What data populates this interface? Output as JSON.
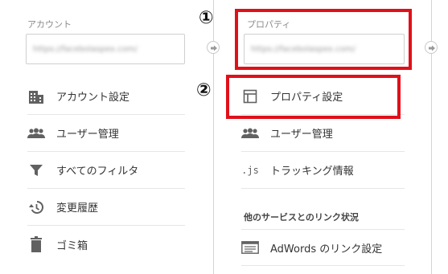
{
  "account_column": {
    "label": "アカウント",
    "selected_value": "https://facebolaspex.com/",
    "menu": [
      {
        "label": "アカウント設定",
        "icon": "building-icon"
      },
      {
        "label": "ユーザー管理",
        "icon": "people-icon"
      },
      {
        "label": "すべてのフィルタ",
        "icon": "filter-icon"
      },
      {
        "label": "変更履歴",
        "icon": "history-icon"
      },
      {
        "label": "ゴミ箱",
        "icon": "trash-icon"
      }
    ]
  },
  "property_column": {
    "label": "プロパティ",
    "selected_value": "https://facebolaspex.com/",
    "menu": [
      {
        "label": "プロパティ設定",
        "icon": "property-settings-icon"
      },
      {
        "label": "ユーザー管理",
        "icon": "people-icon"
      },
      {
        "label": "トラッキング情報",
        "icon": "js-icon",
        "icon_text": ".js"
      }
    ],
    "section_heading": "他のサービスとのリンク状況",
    "links": [
      {
        "label": "AdWords のリンク設定",
        "icon": "adwords-icon"
      }
    ]
  },
  "annotations": {
    "marker_1": "①",
    "marker_2": "②",
    "highlight_color": "#e0101a"
  }
}
